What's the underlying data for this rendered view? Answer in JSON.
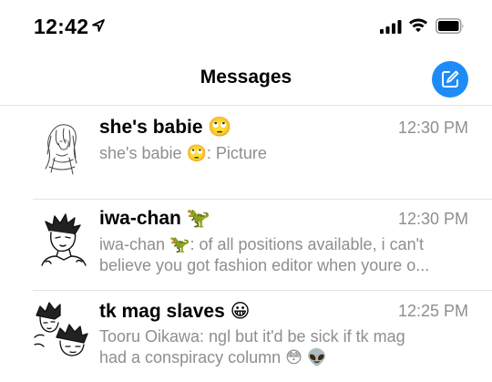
{
  "status_bar": {
    "time": "12:42",
    "icons": [
      "location-arrow-icon",
      "cellular-signal-icon",
      "wifi-icon",
      "battery-icon"
    ]
  },
  "nav": {
    "title": "Messages",
    "compose_icon": "compose-icon",
    "accent_color": "#1d8cf8"
  },
  "conversations": [
    {
      "name": "she's babie 🙄",
      "time": "12:30 PM",
      "preview_lines": [
        "she's babie 🙄: Picture"
      ],
      "avatar": "sketch-girl-avatar"
    },
    {
      "name": "iwa-chan 🦖",
      "time": "12:30 PM",
      "preview_lines": [
        "iwa-chan 🦖: of all positions available, i can't",
        "believe you got fashion editor when youre o..."
      ],
      "avatar": "manga-boy-avatar"
    },
    {
      "name": "tk mag slaves 😀",
      "time": "12:25 PM",
      "preview_lines": [
        "Tooru Oikawa: ngl but it'd be sick if tk mag",
        "had a conspiracy column 😳 👽"
      ],
      "avatar": "group-manga-avatar"
    }
  ]
}
